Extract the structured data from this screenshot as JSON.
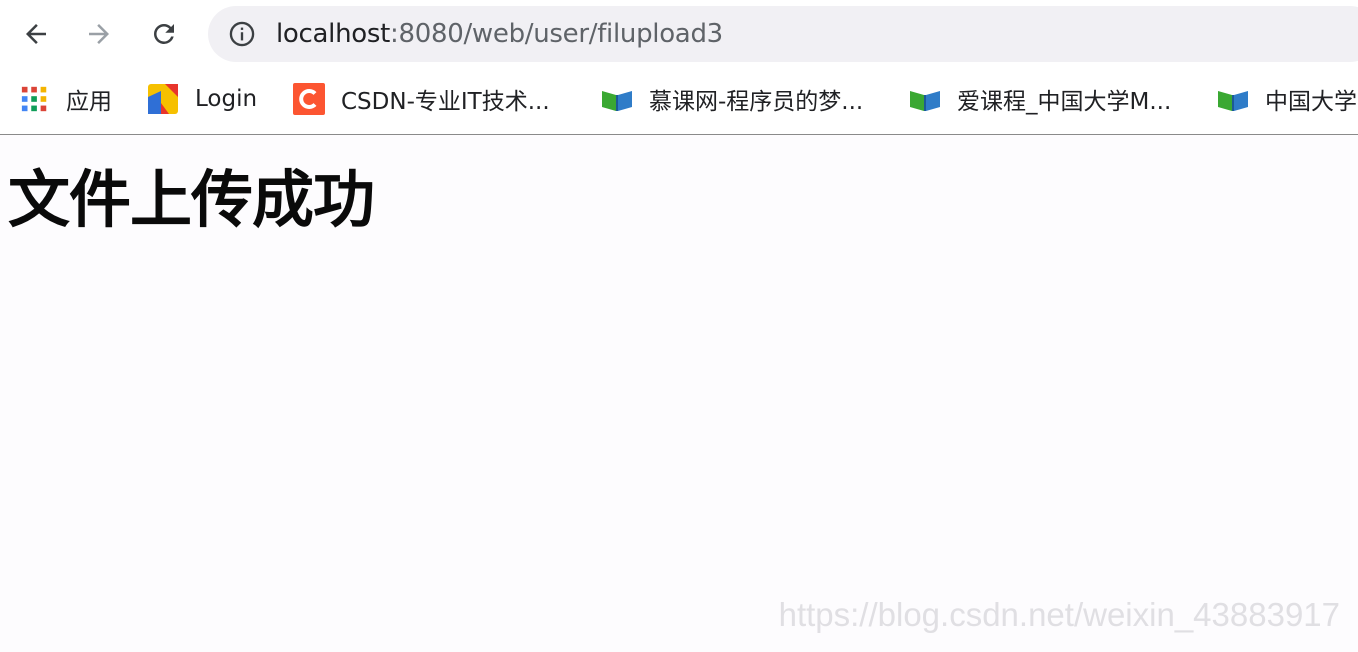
{
  "browser": {
    "url_host": "localhost",
    "url_path": ":8080/web/user/filupload3",
    "icons": {
      "back": "arrow-left-icon",
      "forward": "arrow-right-icon",
      "reload": "reload-icon",
      "site_info": "info-circle-icon"
    }
  },
  "bookmarks": [
    {
      "label": "应用",
      "icon": "apps-grid-icon"
    },
    {
      "label": "Login",
      "icon": "login-favicon"
    },
    {
      "label": "CSDN-专业IT技术...",
      "icon": "csdn-favicon"
    },
    {
      "label": "慕课网-程序员的梦...",
      "icon": "book-favicon"
    },
    {
      "label": "爱课程_中国大学M...",
      "icon": "book-favicon"
    },
    {
      "label": "中国大学",
      "icon": "book-favicon"
    }
  ],
  "page": {
    "heading": "文件上传成功"
  },
  "watermark": "https://blog.csdn.net/weixin_43883917",
  "colors": {
    "page_background": "#fdfcfe",
    "omnibox": "#f1f0f4",
    "csdn_brand": "#fc5531",
    "book_green": "#3aa832",
    "book_blue": "#2f7cc8"
  }
}
